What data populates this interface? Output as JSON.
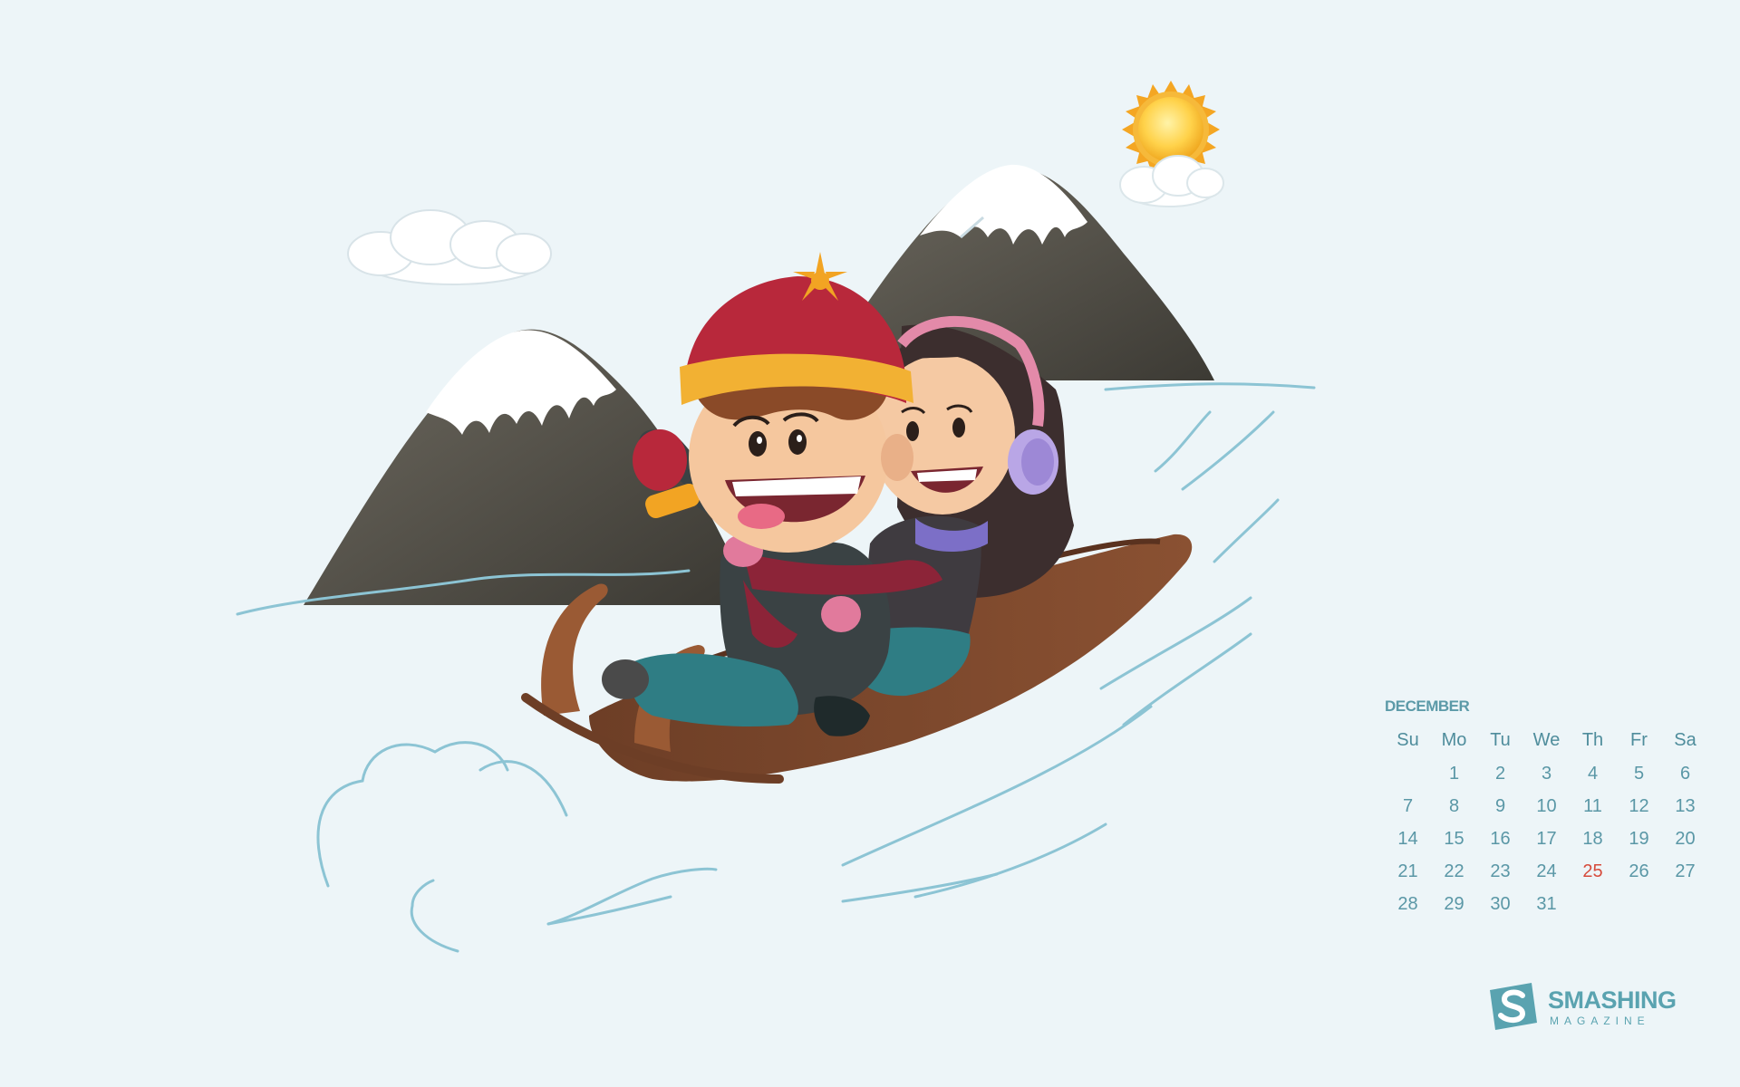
{
  "calendar": {
    "month": "DECEMBER",
    "weekdays": [
      "Su",
      "Mo",
      "Tu",
      "We",
      "Th",
      "Fr",
      "Sa"
    ],
    "weeks": [
      [
        "",
        "1",
        "2",
        "3",
        "4",
        "5",
        "6"
      ],
      [
        "7",
        "8",
        "9",
        "10",
        "11",
        "12",
        "13"
      ],
      [
        "14",
        "15",
        "16",
        "17",
        "18",
        "19",
        "20"
      ],
      [
        "21",
        "22",
        "23",
        "24",
        "25",
        "26",
        "27"
      ],
      [
        "28",
        "29",
        "30",
        "31",
        "",
        "",
        ""
      ]
    ],
    "highlighted_day": "25",
    "highlight_color": "#d64b3c"
  },
  "logo": {
    "name": "SMASHING",
    "subtitle": "MAGAZINE",
    "color": "#5aa3b0"
  },
  "illustration": {
    "icons": [
      "sun-icon",
      "cloud-icon",
      "mountain-icon",
      "sled-icon",
      "boy-icon",
      "girl-icon",
      "snow-swoosh-icon"
    ],
    "background_color": "#edf5f8"
  }
}
